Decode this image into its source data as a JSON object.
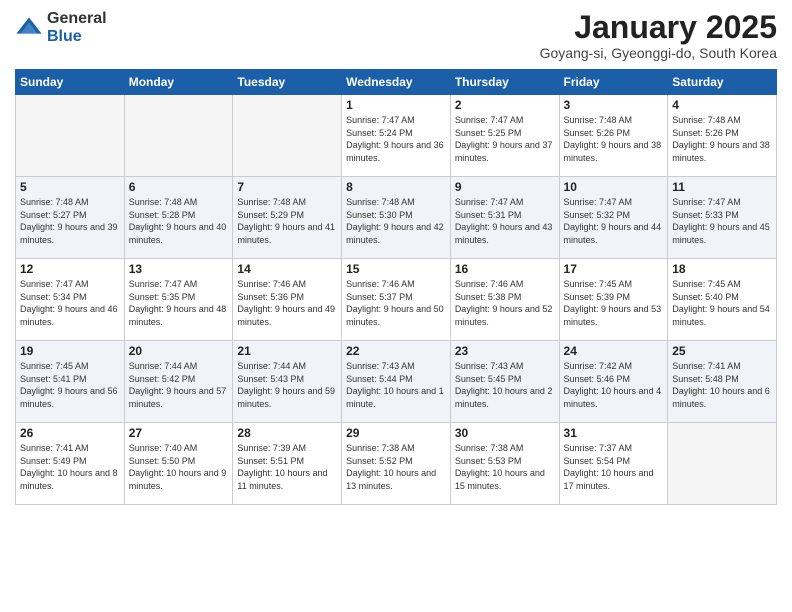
{
  "header": {
    "logo_general": "General",
    "logo_blue": "Blue",
    "month_title": "January 2025",
    "location": "Goyang-si, Gyeonggi-do, South Korea"
  },
  "weekdays": [
    "Sunday",
    "Monday",
    "Tuesday",
    "Wednesday",
    "Thursday",
    "Friday",
    "Saturday"
  ],
  "weeks": [
    [
      {
        "day": "",
        "detail": ""
      },
      {
        "day": "",
        "detail": ""
      },
      {
        "day": "",
        "detail": ""
      },
      {
        "day": "1",
        "detail": "Sunrise: 7:47 AM\nSunset: 5:24 PM\nDaylight: 9 hours\nand 36 minutes."
      },
      {
        "day": "2",
        "detail": "Sunrise: 7:47 AM\nSunset: 5:25 PM\nDaylight: 9 hours\nand 37 minutes."
      },
      {
        "day": "3",
        "detail": "Sunrise: 7:48 AM\nSunset: 5:26 PM\nDaylight: 9 hours\nand 38 minutes."
      },
      {
        "day": "4",
        "detail": "Sunrise: 7:48 AM\nSunset: 5:26 PM\nDaylight: 9 hours\nand 38 minutes."
      }
    ],
    [
      {
        "day": "5",
        "detail": "Sunrise: 7:48 AM\nSunset: 5:27 PM\nDaylight: 9 hours\nand 39 minutes."
      },
      {
        "day": "6",
        "detail": "Sunrise: 7:48 AM\nSunset: 5:28 PM\nDaylight: 9 hours\nand 40 minutes."
      },
      {
        "day": "7",
        "detail": "Sunrise: 7:48 AM\nSunset: 5:29 PM\nDaylight: 9 hours\nand 41 minutes."
      },
      {
        "day": "8",
        "detail": "Sunrise: 7:48 AM\nSunset: 5:30 PM\nDaylight: 9 hours\nand 42 minutes."
      },
      {
        "day": "9",
        "detail": "Sunrise: 7:47 AM\nSunset: 5:31 PM\nDaylight: 9 hours\nand 43 minutes."
      },
      {
        "day": "10",
        "detail": "Sunrise: 7:47 AM\nSunset: 5:32 PM\nDaylight: 9 hours\nand 44 minutes."
      },
      {
        "day": "11",
        "detail": "Sunrise: 7:47 AM\nSunset: 5:33 PM\nDaylight: 9 hours\nand 45 minutes."
      }
    ],
    [
      {
        "day": "12",
        "detail": "Sunrise: 7:47 AM\nSunset: 5:34 PM\nDaylight: 9 hours\nand 46 minutes."
      },
      {
        "day": "13",
        "detail": "Sunrise: 7:47 AM\nSunset: 5:35 PM\nDaylight: 9 hours\nand 48 minutes."
      },
      {
        "day": "14",
        "detail": "Sunrise: 7:46 AM\nSunset: 5:36 PM\nDaylight: 9 hours\nand 49 minutes."
      },
      {
        "day": "15",
        "detail": "Sunrise: 7:46 AM\nSunset: 5:37 PM\nDaylight: 9 hours\nand 50 minutes."
      },
      {
        "day": "16",
        "detail": "Sunrise: 7:46 AM\nSunset: 5:38 PM\nDaylight: 9 hours\nand 52 minutes."
      },
      {
        "day": "17",
        "detail": "Sunrise: 7:45 AM\nSunset: 5:39 PM\nDaylight: 9 hours\nand 53 minutes."
      },
      {
        "day": "18",
        "detail": "Sunrise: 7:45 AM\nSunset: 5:40 PM\nDaylight: 9 hours\nand 54 minutes."
      }
    ],
    [
      {
        "day": "19",
        "detail": "Sunrise: 7:45 AM\nSunset: 5:41 PM\nDaylight: 9 hours\nand 56 minutes."
      },
      {
        "day": "20",
        "detail": "Sunrise: 7:44 AM\nSunset: 5:42 PM\nDaylight: 9 hours\nand 57 minutes."
      },
      {
        "day": "21",
        "detail": "Sunrise: 7:44 AM\nSunset: 5:43 PM\nDaylight: 9 hours\nand 59 minutes."
      },
      {
        "day": "22",
        "detail": "Sunrise: 7:43 AM\nSunset: 5:44 PM\nDaylight: 10 hours\nand 1 minute."
      },
      {
        "day": "23",
        "detail": "Sunrise: 7:43 AM\nSunset: 5:45 PM\nDaylight: 10 hours\nand 2 minutes."
      },
      {
        "day": "24",
        "detail": "Sunrise: 7:42 AM\nSunset: 5:46 PM\nDaylight: 10 hours\nand 4 minutes."
      },
      {
        "day": "25",
        "detail": "Sunrise: 7:41 AM\nSunset: 5:48 PM\nDaylight: 10 hours\nand 6 minutes."
      }
    ],
    [
      {
        "day": "26",
        "detail": "Sunrise: 7:41 AM\nSunset: 5:49 PM\nDaylight: 10 hours\nand 8 minutes."
      },
      {
        "day": "27",
        "detail": "Sunrise: 7:40 AM\nSunset: 5:50 PM\nDaylight: 10 hours\nand 9 minutes."
      },
      {
        "day": "28",
        "detail": "Sunrise: 7:39 AM\nSunset: 5:51 PM\nDaylight: 10 hours\nand 11 minutes."
      },
      {
        "day": "29",
        "detail": "Sunrise: 7:38 AM\nSunset: 5:52 PM\nDaylight: 10 hours\nand 13 minutes."
      },
      {
        "day": "30",
        "detail": "Sunrise: 7:38 AM\nSunset: 5:53 PM\nDaylight: 10 hours\nand 15 minutes."
      },
      {
        "day": "31",
        "detail": "Sunrise: 7:37 AM\nSunset: 5:54 PM\nDaylight: 10 hours\nand 17 minutes."
      },
      {
        "day": "",
        "detail": ""
      }
    ]
  ]
}
